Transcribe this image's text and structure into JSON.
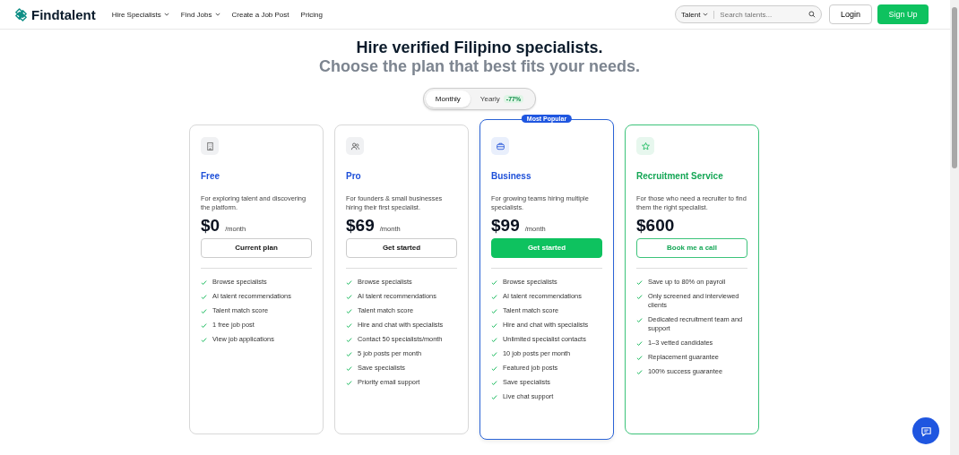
{
  "header": {
    "logo": "Findtalent",
    "nav": [
      {
        "label": "Hire Specialists",
        "dropdown": true
      },
      {
        "label": "Find Jobs",
        "dropdown": true
      },
      {
        "label": "Create a Job Post",
        "dropdown": false
      },
      {
        "label": "Pricing",
        "dropdown": false
      }
    ],
    "search": {
      "category": "Talent",
      "placeholder": "Search talents..."
    },
    "login": "Login",
    "signup": "Sign Up"
  },
  "hero": {
    "title": "Hire verified Filipino specialists.",
    "subtitle": "Choose the plan that best fits your needs."
  },
  "billing_toggle": [
    {
      "label": "Monthly",
      "selected": true
    },
    {
      "label": "Yearly",
      "selected": false,
      "badge": "-77%"
    }
  ],
  "plans": [
    {
      "kind": "free",
      "name": "Free",
      "description": "For exploring talent and discovering the platform.",
      "price": "$0",
      "period": "/month",
      "button": "Current plan",
      "features": [
        "Browse specialists",
        "AI talent recommendations",
        "Talent match score",
        "1 free job post",
        "View job applications"
      ]
    },
    {
      "kind": "pro",
      "name": "Pro",
      "description": "For founders & small businesses hiring their first specialist.",
      "price": "$69",
      "period": "/month",
      "button": "Get started",
      "features": [
        "Browse specialists",
        "AI talent recommendations",
        "Talent match score",
        "Hire and chat with specialists",
        "Contact 50 specialists/month",
        "5 job posts per month",
        "Save specialists",
        "Priority email support"
      ]
    },
    {
      "kind": "business",
      "name": "Business",
      "badge": "Most Popular",
      "description": "For growing teams hiring multiple specialists.",
      "price": "$99",
      "period": "/month",
      "button": "Get started",
      "features": [
        "Browse specialists",
        "AI talent recommendations",
        "Talent match score",
        "Hire and chat with specialists",
        "Unlimited specialist contacts",
        "10 job posts per month",
        "Featured job posts",
        "Save specialists",
        "Live chat support"
      ]
    },
    {
      "kind": "service",
      "name": "Recruitment Service",
      "description": "For those who need a recruiter to find them the right specialist.",
      "price": "$600",
      "button": "Book me a call",
      "features": [
        "Save up to 80% on payroll",
        "Only screened and interviewed clients",
        "Dedicated recruitment team and support",
        "1–3 vetted candidates",
        "Replacement guarantee",
        "100% success guarantee"
      ]
    }
  ]
}
